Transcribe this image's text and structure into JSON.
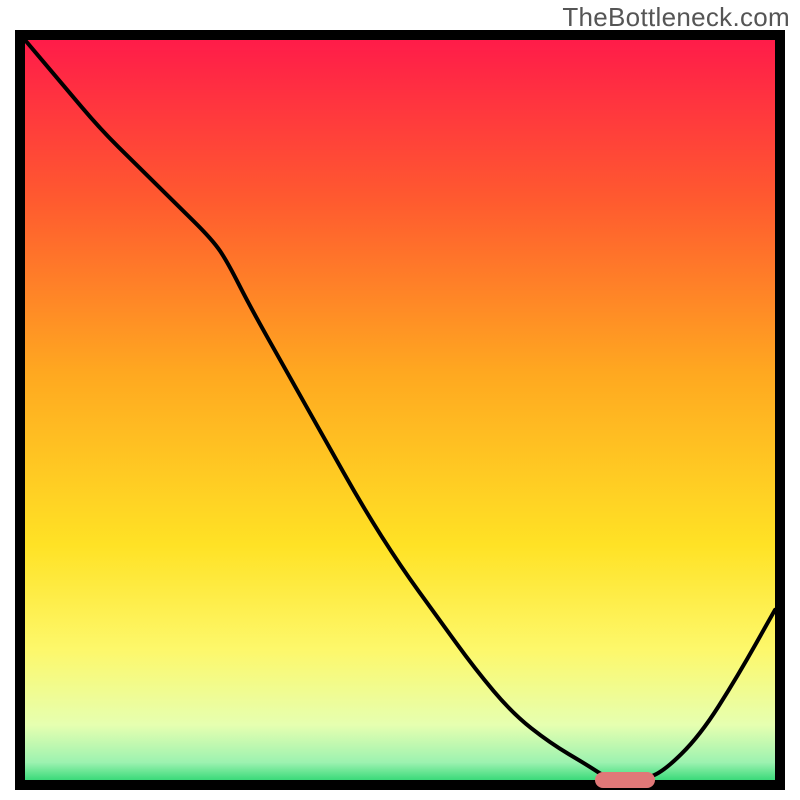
{
  "watermark": "TheBottleneck.com",
  "chart_data": {
    "type": "line",
    "title": "",
    "xlabel": "",
    "ylabel": "",
    "xlim": [
      0,
      100
    ],
    "ylim": [
      0,
      100
    ],
    "grid": false,
    "legend": false,
    "background_gradient": {
      "direction": "vertical",
      "stops": [
        {
          "pos": 0.0,
          "color": "#ff1a4a"
        },
        {
          "pos": 0.22,
          "color": "#ff5a2f"
        },
        {
          "pos": 0.45,
          "color": "#ffa820"
        },
        {
          "pos": 0.68,
          "color": "#ffe225"
        },
        {
          "pos": 0.82,
          "color": "#fdf86b"
        },
        {
          "pos": 0.92,
          "color": "#e6ffb0"
        },
        {
          "pos": 0.97,
          "color": "#9cf2b0"
        },
        {
          "pos": 1.0,
          "color": "#1fd36a"
        }
      ]
    },
    "series": [
      {
        "name": "curve",
        "color": "#000000",
        "x": [
          0,
          5,
          10,
          15,
          20,
          25,
          27,
          30,
          35,
          40,
          45,
          50,
          55,
          60,
          65,
          70,
          75,
          78,
          82,
          85,
          90,
          95,
          100
        ],
        "y": [
          100,
          94,
          88,
          83,
          78,
          73,
          70,
          64,
          55,
          46,
          37,
          29,
          22,
          15,
          9,
          5,
          2,
          0,
          0,
          1,
          6,
          14,
          23
        ]
      }
    ],
    "marker": {
      "name": "optimum-marker",
      "color": "#e07878",
      "x_range": [
        76,
        84
      ],
      "y": 0,
      "shape": "rounded-bar"
    }
  }
}
